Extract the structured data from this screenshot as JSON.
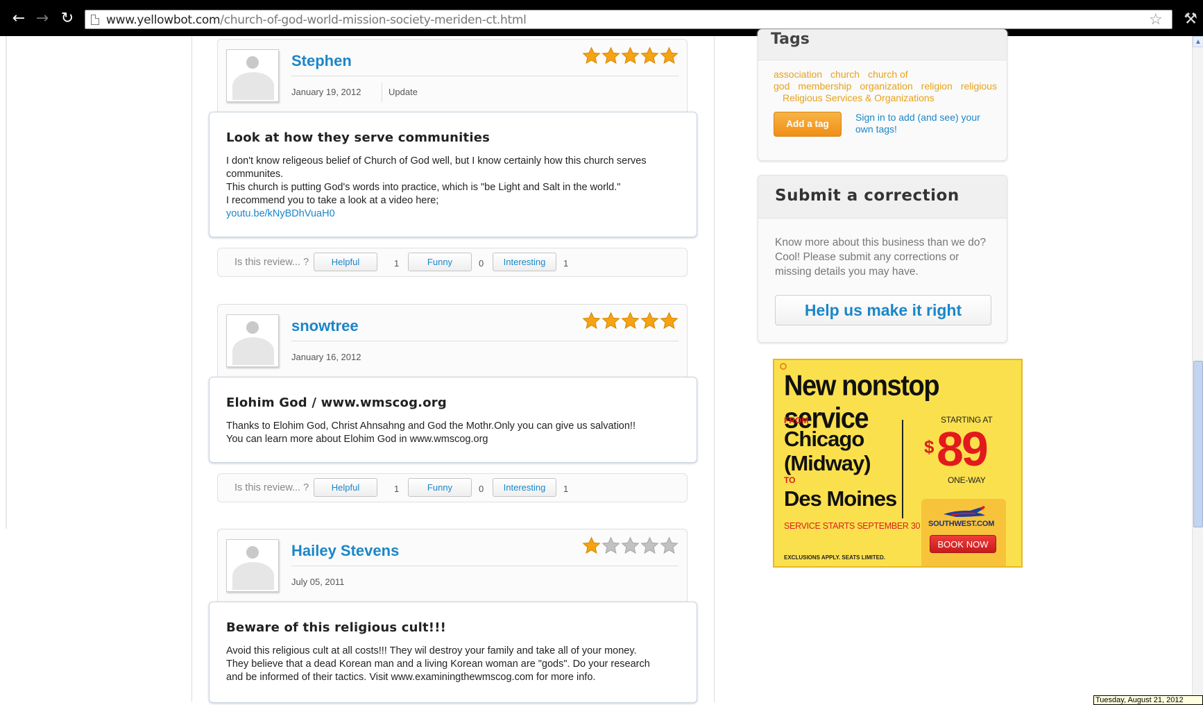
{
  "browser": {
    "url_domain": "www.yellowbot.com",
    "url_path": "/church-of-god-world-mission-society-meriden-ct.html"
  },
  "reviews": [
    {
      "name": "Stephen",
      "rating": 5,
      "date": "January 19, 2012",
      "update_label": "Update",
      "title": "Look at how they serve communities",
      "text": "I don't know religeous belief of Church of God well, but I know certainly how this church serves communites.\nThis church is putting God's words into practice, which is \"be Light and Salt in the world.\"\nI recommend you to take a look at a video here;",
      "link": "youtu.be/kNyBDhVuaH0",
      "votes": {
        "question": "Is this review... ?",
        "helpful_label": "Helpful",
        "helpful": "1",
        "funny_label": "Funny",
        "funny": "0",
        "interesting_label": "Interesting",
        "interesting": "1"
      }
    },
    {
      "name": "snowtree",
      "rating": 5,
      "date": "January 16, 2012",
      "title": "Elohim God / www.wmscog.org",
      "text": "Thanks to Elohim God, Christ Ahnsahng and God the Mothr.Only you can give us salvation!!\nYou can learn more about Elohim God in www.wmscog.org",
      "votes": {
        "question": "Is this review... ?",
        "helpful_label": "Helpful",
        "helpful": "1",
        "funny_label": "Funny",
        "funny": "0",
        "interesting_label": "Interesting",
        "interesting": "1"
      }
    },
    {
      "name": "Hailey Stevens",
      "rating": 1,
      "date": "July 05, 2011",
      "title": "Beware of this religious cult!!!",
      "text": "Avoid this religious cult at all costs!!! They wil destroy your family and take all of your money.\nThey believe that a dead Korean man and a living Korean woman are \"gods\". Do your research\nand be informed of their tactics. Visit www.examiningthewmscog.com for more info."
    }
  ],
  "sidebar": {
    "tags_title": "Tags",
    "tags": [
      "association",
      "church",
      "church of god",
      "membership",
      "organization",
      "religion",
      "religious"
    ],
    "tags_last": "Religious Services & Organizations",
    "add_tag_label": "Add a tag",
    "sign_in_text": "Sign in to add (and see) your own tags!",
    "correction_title": "Submit a correction",
    "correction_text": "Know more about this business than we do? Cool! Please submit any corrections or missing details you may have.",
    "correction_button": "Help us make it right"
  },
  "ad": {
    "headline": "New nonstop service",
    "from_label": "FROM",
    "from_city_1": "Chicago",
    "from_city_2": "(Midway)",
    "to_label": "TO",
    "to_city": "Des Moines",
    "service_starts": "SERVICE STARTS SEPTEMBER 30",
    "exclusions": "EXCLUSIONS APPLY. SEATS LIMITED.",
    "starting_at": "STARTING AT",
    "currency": "$",
    "price": "89",
    "one_way": "ONE-WAY",
    "brand": "SOUTHWEST.COM",
    "book_now": "BOOK NOW"
  },
  "taskbar_clock": "Tuesday, August 21, 2012",
  "colors": {
    "link_blue": "#1a86c8",
    "tag_orange": "#e6a21a",
    "star_gold": "#f6a313",
    "ad_yellow": "#fbe04d",
    "ad_red": "#e2191d"
  }
}
